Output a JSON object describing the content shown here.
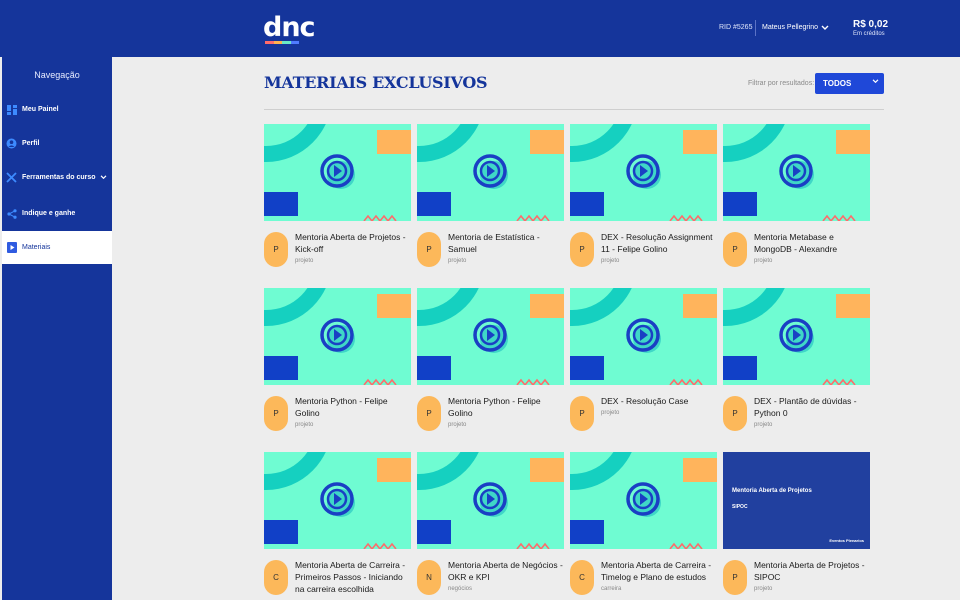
{
  "header": {
    "logo": "dnc",
    "logo_colors": [
      "#ff6b6b",
      "#ffb14e",
      "#6ae8c6",
      "#4f7bff"
    ],
    "rid": "RID #5265",
    "user_name": "Mateus Pellegrino",
    "credits_amount": "R$ 0,02",
    "credits_label": "Em créditos"
  },
  "sidebar": {
    "title": "Navegação",
    "items": [
      {
        "label": "Meu Painel",
        "icon": "dashboard-icon"
      },
      {
        "label": "Perfil",
        "icon": "profile-icon"
      },
      {
        "label": "Ferramentas do curso",
        "icon": "tools-icon"
      },
      {
        "label": "Indique e ganhe",
        "icon": "share-icon"
      },
      {
        "label": "Materiais",
        "icon": "play-icon",
        "active": true
      }
    ]
  },
  "main": {
    "title": "MATERIAIS EXCLUSIVOS",
    "filter_label": "Filtrar por resultados:",
    "filter_value": "TODOS"
  },
  "colors": {
    "brand_blue": "#15359b",
    "accent_blue": "#1f48d8",
    "thumb_mint": "#6ffcd2",
    "avatar_orange": "#fcb85a"
  },
  "cards": [
    {
      "avatar": "P",
      "title": "Mentoria Aberta de Projetos - Kick-off",
      "tag": "projeto"
    },
    {
      "avatar": "P",
      "title": "Mentoria de Estatística - Samuel",
      "tag": "projeto"
    },
    {
      "avatar": "P",
      "title": "DEX - Resolução Assignment 11 - Felipe Golino",
      "tag": "projeto"
    },
    {
      "avatar": "P",
      "title": "Mentoria Metabase e MongoDB - Alexandre",
      "tag": "projeto"
    },
    {
      "avatar": "P",
      "title": "Mentoria Python - Felipe Golino",
      "tag": "projeto"
    },
    {
      "avatar": "P",
      "title": "Mentoria Python - Felipe Golino",
      "tag": "projeto"
    },
    {
      "avatar": "P",
      "title": "DEX - Resolução Case",
      "tag": "projeto"
    },
    {
      "avatar": "P",
      "title": "DEX - Plantão de dúvidas - Python 0",
      "tag": "projeto"
    },
    {
      "avatar": "C",
      "title": "Mentoria Aberta de Carreira - Primeiros Passos - Iniciando na carreira escolhida",
      "tag": ""
    },
    {
      "avatar": "N",
      "title": "Mentoria Aberta de Negócios - OKR e KPI",
      "tag": "negócios"
    },
    {
      "avatar": "C",
      "title": "Mentoria Aberta de Carreira - Timelog e Plano de estudos",
      "tag": "carreira"
    },
    {
      "avatar": "P",
      "title": "Mentoria Aberta de Projetos - SIPOC",
      "tag": "projeto",
      "thumb_text": {
        "title": "Mentoria Aberta de Projetos",
        "subtitle": "SIPOC",
        "footer": "Eventos Plenarios"
      }
    }
  ]
}
